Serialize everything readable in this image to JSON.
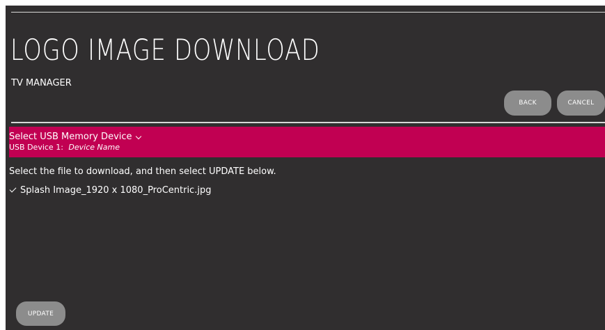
{
  "page": {
    "title": "LOGO IMAGE DOWNLOAD",
    "subtitle": "TV MANAGER"
  },
  "header_buttons": {
    "back_label": "BACK",
    "cancel_label": "CANCEL"
  },
  "usb_selector": {
    "label": "Select USB Memory Device",
    "device_prefix": "USB Device 1:",
    "device_name": "Device Name",
    "icon": "chevron-down-icon",
    "accent_color": "#c10052"
  },
  "content": {
    "instruction": "Select the file to download, and then select UPDATE below.",
    "files": [
      {
        "name": "Splash Image_1920 x 1080_ProCentric.jpg",
        "selected": true,
        "icon": "check-icon"
      }
    ]
  },
  "footer": {
    "update_label": "UPDATE"
  }
}
